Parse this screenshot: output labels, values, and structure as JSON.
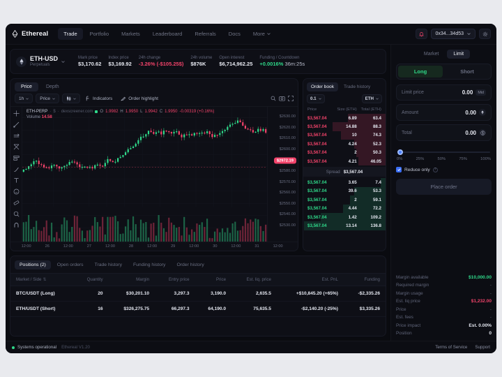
{
  "topnav": {
    "brand": "Ethereal",
    "links": [
      {
        "label": "Trade",
        "active": true
      },
      {
        "label": "Portfolio",
        "active": false
      },
      {
        "label": "Markets",
        "active": false
      },
      {
        "label": "Leaderboard",
        "active": false
      },
      {
        "label": "Referrals",
        "active": false
      },
      {
        "label": "Docs",
        "active": false
      },
      {
        "label": "More",
        "active": false
      }
    ],
    "wallet": "0x34...34d53"
  },
  "market": {
    "symbol": "ETH-USD",
    "subtitle": "Perpetuals",
    "stats": [
      {
        "label": "Mark price",
        "value": "$3,170.62",
        "tone": "neutral"
      },
      {
        "label": "Index price",
        "value": "$3,169.92",
        "tone": "neutral"
      },
      {
        "label": "24h change",
        "value": "-3.26% (-$105.25$)",
        "tone": "neg"
      },
      {
        "label": "24h volume",
        "value": "$876K",
        "tone": "neutral"
      },
      {
        "label": "Open interest",
        "value": "$6,714,962.25",
        "tone": "neutral"
      },
      {
        "label": "Funding / Countdown",
        "value": "+0.0016%",
        "extra": "36m:25s",
        "tone": "pos"
      }
    ]
  },
  "chart": {
    "tabs": [
      {
        "label": "Price",
        "active": true
      },
      {
        "label": "Depth",
        "active": false
      }
    ],
    "toolbar": {
      "interval": "1h",
      "series_type": "Price",
      "indicators": "Indicators",
      "order_highlight": "Order highlight"
    },
    "legend": {
      "symbol": "ETH-PERP",
      "sep1": "·",
      "currency": "$",
      "sep2": "·",
      "source": "dexscreener.com",
      "o_label": "O",
      "o": "1.9982",
      "h_label": "H",
      "h": "1.9950",
      "l_label": "L",
      "l": "1.9942",
      "c_label": "C",
      "c": "1.9950",
      "delta": "-0.00319 (+0.16%)",
      "volume_label": "Volume",
      "volume": "14.58"
    },
    "price_axis": [
      "$2630.00",
      "$2620.00",
      "$2610.00",
      "$2600.00",
      "$2590.00",
      "$2580.00",
      "$2570.00",
      "$2560.00",
      "$2550.00",
      "$2540.00",
      "$2530.00"
    ],
    "current_price": "$2972.19",
    "time_axis": [
      "12:00",
      "26",
      "12:00",
      "27",
      "12:00",
      "28",
      "12:00",
      "29",
      "12:00",
      "30",
      "12:00",
      "31",
      "12:00"
    ]
  },
  "orderbook": {
    "tabs": [
      {
        "label": "Order book",
        "active": true
      },
      {
        "label": "Trade history",
        "active": false
      }
    ],
    "precision": "0.1",
    "unit": "ETH",
    "columns": [
      "Price",
      "Size (ETH)",
      "Total (ETH)"
    ],
    "asks": [
      {
        "price": "$3,567.04",
        "size": "6.89",
        "total": "63.4",
        "fill": 46,
        "highlight": true
      },
      {
        "price": "$3,567.04",
        "size": "14.88",
        "total": "88.3",
        "fill": 64
      },
      {
        "price": "$3,567.04",
        "size": "10",
        "total": "74.3",
        "fill": 54
      },
      {
        "price": "$3,567.04",
        "size": "4.24",
        "total": "52.3",
        "fill": 38
      },
      {
        "price": "$3,567.04",
        "size": "2",
        "total": "50.3",
        "fill": 36
      },
      {
        "price": "$3,567.04",
        "size": "4.21",
        "total": "46.05",
        "fill": 33
      }
    ],
    "spread_label": "Spread",
    "spread_value": "$3,567.04",
    "bids": [
      {
        "price": "$3,567.04",
        "size": "3.65",
        "total": "7.4",
        "fill": 6
      },
      {
        "price": "$3,567.04",
        "size": "39.6",
        "total": "53.3",
        "fill": 38
      },
      {
        "price": "$3,567.04",
        "size": "2",
        "total": "59.1",
        "fill": 43
      },
      {
        "price": "$3,567.04",
        "size": "4.44",
        "total": "72.2",
        "fill": 52
      },
      {
        "price": "$3,567.04",
        "size": "1.42",
        "total": "109.2",
        "fill": 79
      },
      {
        "price": "$3,567.04",
        "size": "13.14",
        "total": "136.8",
        "fill": 99
      }
    ]
  },
  "positions": {
    "tabs": [
      {
        "label": "Positions (2)",
        "active": true
      },
      {
        "label": "Open orders",
        "active": false
      },
      {
        "label": "Trade history",
        "active": false
      },
      {
        "label": "Funding history",
        "active": false
      },
      {
        "label": "Order history",
        "active": false
      }
    ],
    "columns": [
      "Market / Side",
      "Quantity",
      "Margin",
      "Entry price",
      "Price",
      "Est. liq. price",
      "Est. PnL",
      "Funding"
    ],
    "rows": [
      {
        "market": "BTC/USDT (Long)",
        "side": "long",
        "quantity": "20",
        "margin": "$30,201.10",
        "entry": "3,297.3",
        "price": "3,190.0",
        "liq": "2,635.5",
        "pnl": "+$10,845.20 (+65%)",
        "pnl_tone": "pos",
        "funding": "-$2,335.26",
        "funding_tone": "neg"
      },
      {
        "market": "ETH/USDT (Short)",
        "side": "short",
        "quantity": "16",
        "margin": "$326,275.75",
        "entry": "66,297.3",
        "price": "64,190.0",
        "liq": "75,635.5",
        "pnl": "-$2,140.20 (-25%)",
        "pnl_tone": "neg",
        "funding": "$3,335.26",
        "funding_tone": "pos"
      }
    ]
  },
  "orderform": {
    "type_tabs": [
      {
        "label": "Market",
        "active": false
      },
      {
        "label": "Limit",
        "active": true
      }
    ],
    "side_long": "Long",
    "side_short": "Short",
    "fields": [
      {
        "label": "Limit price",
        "value": "0.00",
        "tag": "Mid"
      },
      {
        "label": "Amount",
        "value": "0.00",
        "icon": "eth-icon"
      },
      {
        "label": "Total",
        "value": "0.00",
        "icon": "usd-icon"
      }
    ],
    "slider_ticks": [
      "0%",
      "25%",
      "50%",
      "75%",
      "100%"
    ],
    "reduce_only": "Reduce only",
    "place_order": "Place order",
    "summary": [
      {
        "label": "Margin available",
        "value": "$10,000.00",
        "tone": "green"
      },
      {
        "label": "Required margin",
        "value": "-",
        "tone": "dash"
      },
      {
        "label": "Margin usage",
        "value": "-",
        "tone": "dash"
      },
      {
        "label": "Est. liq price",
        "value": "$1,232.00",
        "tone": "pink"
      },
      {
        "label": "Price",
        "value": "-",
        "tone": "dash"
      },
      {
        "label": "Est. fees",
        "value": "-",
        "tone": "dash"
      },
      {
        "label": "Price impact",
        "value": "Est. 0.00%",
        "tone": "plain"
      },
      {
        "label": "Position",
        "value": "0",
        "tone": "plain"
      }
    ]
  },
  "footer": {
    "status": "Systems operational",
    "version": "Ethereal V1.20",
    "links": [
      "Terms of Service",
      "Support"
    ]
  }
}
